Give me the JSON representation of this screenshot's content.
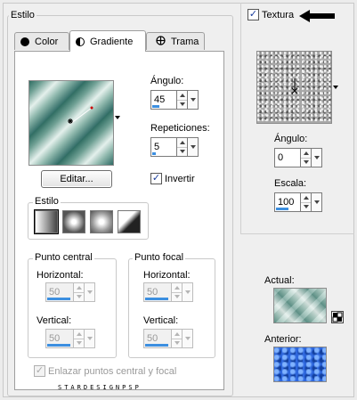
{
  "estilo_panel": {
    "title": "Estilo",
    "tabs": [
      {
        "label": "Color",
        "icon": "color-dot-icon"
      },
      {
        "label": "Gradiente",
        "icon": "half-circle-icon"
      },
      {
        "label": "Trama",
        "icon": "pattern-globe-icon"
      }
    ],
    "active_tab": "Gradiente"
  },
  "gradient": {
    "angle_label": "Ángulo:",
    "angle_value": "45",
    "angle_fraction": 0.125,
    "repeats_label": "Repeticiones:",
    "repeats_value": "5",
    "repeats_fraction": 0.05,
    "edit_button": "Editar...",
    "invert_label": "Invertir",
    "invert_checked": true,
    "style_group_label": "Estilo",
    "style_options": [
      "linear",
      "rectangular",
      "sunburst",
      "radial"
    ],
    "center_point": {
      "title": "Punto central",
      "horizontal_label": "Horizontal:",
      "horizontal_value": "50",
      "vertical_label": "Vertical:",
      "vertical_value": "50"
    },
    "focal_point": {
      "title": "Punto focal",
      "horizontal_label": "Horizontal:",
      "horizontal_value": "50",
      "vertical_label": "Vertical:",
      "vertical_value": "50"
    },
    "link_label": "Enlazar puntos central y focal",
    "link_checked": true,
    "watermark": "STARDESIGNPSP"
  },
  "texture": {
    "checkbox_label": "Textura",
    "checked": true,
    "angle_label": "Ángulo:",
    "angle_value": "0",
    "scale_label": "Escala:",
    "scale_value": "100",
    "arrow_icon": "left-arrow-icon"
  },
  "preview": {
    "actual_label": "Actual:",
    "anterior_label": "Anterior:",
    "swap_icon": "swap-icon"
  },
  "colors": {
    "spin_bar": "#3c8fe0",
    "check_mark": "#1a3d9c"
  }
}
